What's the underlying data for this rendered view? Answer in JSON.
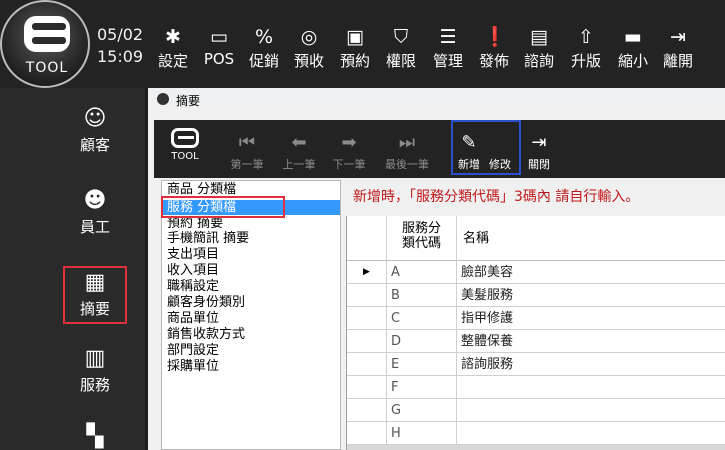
{
  "app": {
    "logo_text": "TOOL",
    "date": "05/02",
    "time": "15:09"
  },
  "nav": [
    {
      "label": "設定",
      "icon": "gear-icon"
    },
    {
      "label": "POS",
      "icon": "monitor-icon"
    },
    {
      "label": "促銷",
      "icon": "discount-icon"
    },
    {
      "label": "預收",
      "icon": "coins-icon"
    },
    {
      "label": "預約",
      "icon": "calendar-icon"
    },
    {
      "label": "權限",
      "icon": "shield-icon"
    },
    {
      "label": "管理",
      "icon": "database-icon"
    },
    {
      "label": "發佈",
      "icon": "alert-bubble-icon"
    },
    {
      "label": "諮詢",
      "icon": "chat-icon"
    },
    {
      "label": "升版",
      "icon": "upgrade-icon"
    },
    {
      "label": "縮小",
      "icon": "minimize-icon"
    },
    {
      "label": "離開",
      "icon": "exit-icon"
    }
  ],
  "side_menu": [
    {
      "label": "顧客",
      "icon": "customer-basket-icon"
    },
    {
      "label": "員工",
      "icon": "staff-icon"
    },
    {
      "label": "摘要",
      "icon": "summary-icon"
    },
    {
      "label": "服務",
      "icon": "briefcase-icon"
    }
  ],
  "window": {
    "title": "摘要"
  },
  "toolbar": {
    "logo_text": "TOOL",
    "buttons": [
      {
        "label": "第一筆",
        "icon": "first-icon"
      },
      {
        "label": "上一筆",
        "icon": "prev-icon"
      },
      {
        "label": "下一筆",
        "icon": "next-icon"
      },
      {
        "label": "最後一筆",
        "icon": "last-icon"
      },
      {
        "label": "新增",
        "icon": "add-icon"
      },
      {
        "label": "修改",
        "icon": "edit-icon"
      },
      {
        "label": "關閉",
        "icon": "close-door-icon"
      }
    ]
  },
  "categories": [
    "商品 分類檔",
    "服務 分類檔",
    "預約 摘要",
    "手機簡訊 摘要",
    "支出項目",
    "收入項目",
    "職稱設定",
    "顧客身份類別",
    "商品單位",
    "銷售收款方式",
    "部門設定",
    "採購單位"
  ],
  "hint": "新增時，「服務分類代碼」3碼內 請自行輸入。",
  "table": {
    "columns": [
      "服務分類代碼",
      "名稱"
    ],
    "column1_line1": "服務分",
    "column1_line2": "類代碼",
    "current_row_marker": "▶",
    "rows": [
      {
        "code": "A",
        "name": "臉部美容"
      },
      {
        "code": "B",
        "name": "美髮服務"
      },
      {
        "code": "C",
        "name": "指甲修護"
      },
      {
        "code": "D",
        "name": "整體保養"
      },
      {
        "code": "E",
        "name": "諮詢服務"
      },
      {
        "code": "F",
        "name": ""
      },
      {
        "code": "G",
        "name": ""
      },
      {
        "code": "H",
        "name": ""
      }
    ]
  }
}
